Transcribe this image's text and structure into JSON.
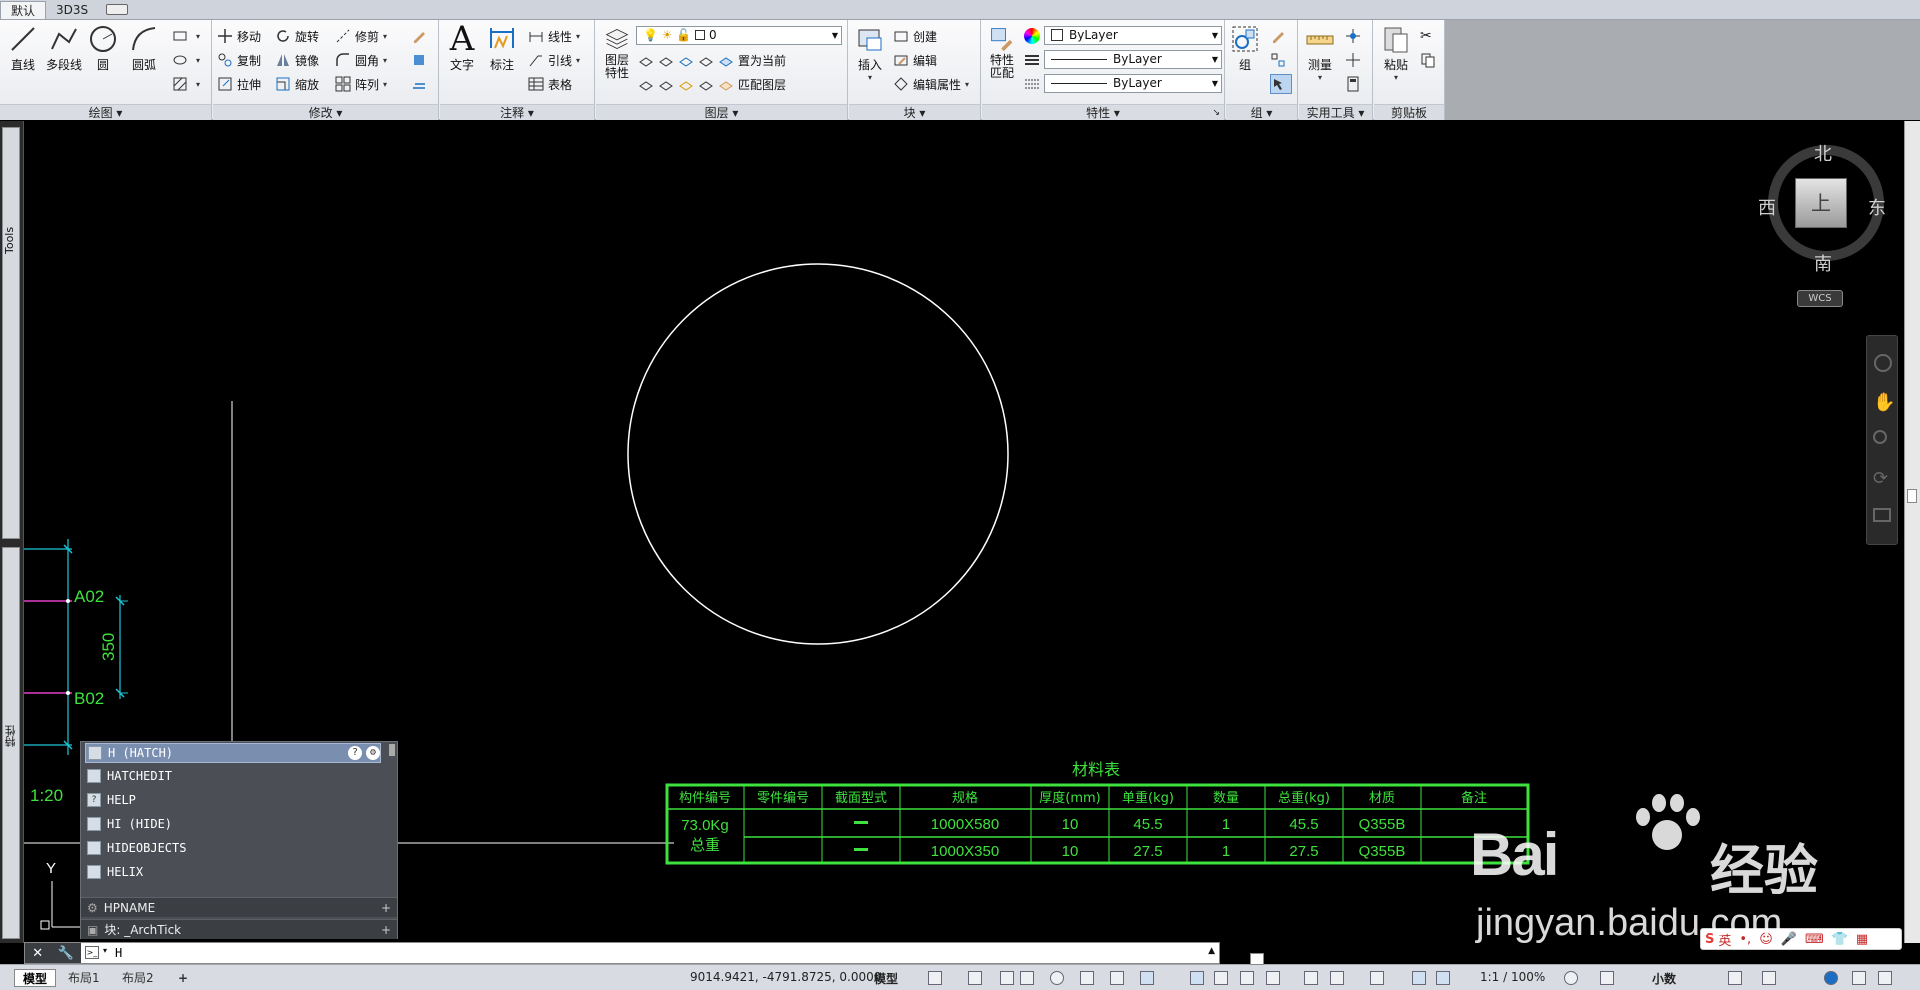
{
  "tabs": [
    {
      "label": "默认",
      "active": true
    },
    {
      "label": "3D3S",
      "active": false
    }
  ],
  "ribbon": {
    "draw": {
      "title": "绘图",
      "line": "直线",
      "polyline": "多段线",
      "circle": "圆",
      "arc": "圆弧"
    },
    "modify": {
      "title": "修改",
      "move": "移动",
      "rotate": "旋转",
      "trim": "修剪",
      "copy": "复制",
      "mirror": "镜像",
      "fillet": "圆角",
      "stretch": "拉伸",
      "scale": "缩放",
      "array": "阵列"
    },
    "annotate": {
      "title": "注释",
      "text": "文字",
      "dim": "标注",
      "linear": "线性",
      "leader": "引线",
      "table": "表格"
    },
    "layers": {
      "title": "图层",
      "props_l1": "图层",
      "props_l2": "特性",
      "current_layer": "0",
      "set_current": "置为当前",
      "match_layer": "匹配图层"
    },
    "block": {
      "title": "块",
      "insert": "插入",
      "create": "创建",
      "edit": "编辑",
      "edit_attr": "编辑属性"
    },
    "properties": {
      "title": "特性",
      "match_l1": "特性",
      "match_l2": "匹配",
      "color": "ByLayer",
      "linetype": "ByLayer",
      "lineweight": "ByLayer"
    },
    "groups": {
      "title": "组",
      "group": "组"
    },
    "utilities": {
      "title": "实用工具",
      "measure": "测量"
    },
    "clipboard": {
      "title": "剪贴板",
      "paste": "粘贴"
    }
  },
  "side": {
    "tools": "Tools",
    "props": "特性"
  },
  "viewcube": {
    "n": "北",
    "s": "南",
    "e": "东",
    "w": "西",
    "face": "上",
    "wcs": "WCS"
  },
  "drawing": {
    "label_a": "A02",
    "label_b": "B02",
    "dim": "350",
    "scale": "1:20",
    "ucs_y": "Y",
    "table": {
      "title": "材料表",
      "headers": [
        "构件编号",
        "零件编号",
        "截面型式",
        "规格",
        "厚度(mm)",
        "单重(kg)",
        "数量",
        "总重(kg)",
        "材质",
        "备注"
      ],
      "weight": "73.0Kg",
      "weight_label": "总重",
      "rows": [
        {
          "spec": "1000X580",
          "thk": "10",
          "unit": "45.5",
          "qty": "1",
          "total": "45.5",
          "mat": "Q355B"
        },
        {
          "spec": "1000X350",
          "thk": "10",
          "unit": "27.5",
          "qty": "1",
          "total": "27.5",
          "mat": "Q355B"
        }
      ]
    }
  },
  "autocomplete": {
    "items": [
      "H (HATCH)",
      "HATCHEDIT",
      "HELP",
      "HI (HIDE)",
      "HIDEOBJECTS",
      "HELIX"
    ],
    "sub1": "HPNAME",
    "sub2": "块: _ArchTick"
  },
  "command": {
    "value": "H"
  },
  "status": {
    "tabs": [
      {
        "label": "模型",
        "active": true
      },
      {
        "label": "布局1",
        "active": false
      },
      {
        "label": "布局2",
        "active": false
      }
    ],
    "coords": "9014.9421, -4791.8725, 0.0000",
    "mode": "模型",
    "scale": "1:1 / 100%",
    "units": "小数"
  },
  "watermark": {
    "brand": "Bai",
    "brand2": "经验",
    "url": "jingyan.baidu.com"
  },
  "ime": "英"
}
